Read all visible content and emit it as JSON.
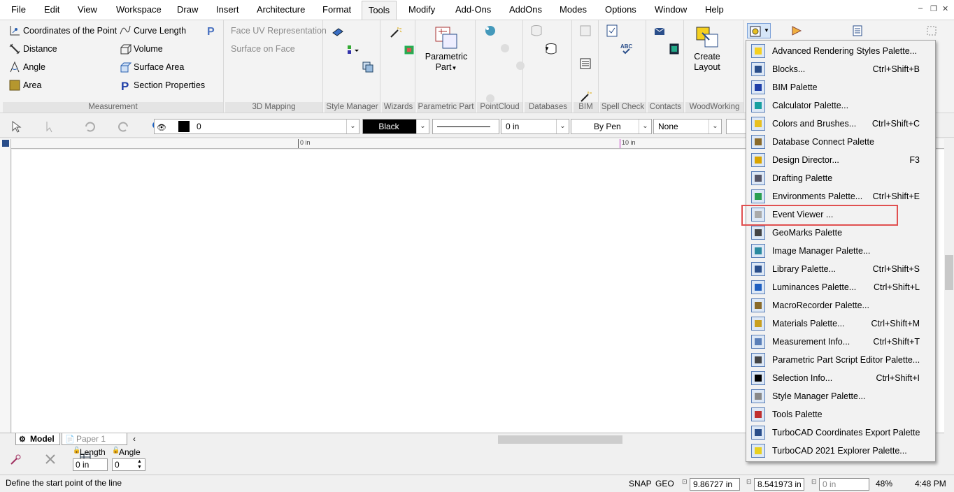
{
  "menu": {
    "items": [
      "File",
      "Edit",
      "View",
      "Workspace",
      "Draw",
      "Insert",
      "Architecture",
      "Format",
      "Tools",
      "Modify",
      "Add-Ons",
      "AddOns",
      "Modes",
      "Options",
      "Window",
      "Help"
    ],
    "active": "Tools"
  },
  "ribbon": {
    "measurement": {
      "col1": [
        "Coordinates of the Point",
        "Distance",
        "Angle",
        "Area"
      ],
      "col2": [
        "Curve Length",
        "Volume",
        "Surface Area",
        "Section Properties"
      ],
      "label": "Measurement"
    },
    "mapping": {
      "items": [
        "Face UV Representation",
        "Surface on Face"
      ],
      "label": "3D Mapping"
    },
    "parametric_part": {
      "button": "Parametric",
      "button2": "Part",
      "label": "Parametric Part"
    },
    "create_layout": {
      "line1": "Create",
      "line2": "Layout"
    },
    "group_labels": {
      "style_manager": "Style Manager",
      "wizards": "Wizards",
      "pointcloud": "PointCloud",
      "databases": "Databases",
      "bim": "BIM",
      "spell_check": "Spell Check",
      "contacts": "Contacts",
      "woodworking": "WoodWorking"
    }
  },
  "toolbar": {
    "layer_value": "0",
    "color_value": "Black",
    "thickness_value": "0 in",
    "pen_value": "By Pen",
    "fill_value": "None"
  },
  "ruler": {
    "mark0": "0 in",
    "mark10": "10 in"
  },
  "tabs": {
    "model": "Model",
    "paper": "Paper 1"
  },
  "inspector": {
    "length_label": "Length",
    "angle_label": "Angle",
    "length_value": "0 in",
    "angle_value": "0"
  },
  "status": {
    "message": "Define the start point of the line",
    "snap": "SNAP",
    "geo": "GEO",
    "x": "9.86727 in",
    "y": "8.541973 in",
    "z": "0 in",
    "zoom": "48%",
    "time": "4:48 PM"
  },
  "dropdown": {
    "items": [
      {
        "label": "Advanced Rendering Styles Palette...",
        "shortcut": ""
      },
      {
        "label": "Blocks...",
        "shortcut": "Ctrl+Shift+B"
      },
      {
        "label": "BIM Palette",
        "shortcut": ""
      },
      {
        "label": "Calculator Palette...",
        "shortcut": ""
      },
      {
        "label": "Colors and Brushes...",
        "shortcut": "Ctrl+Shift+C"
      },
      {
        "label": "Database Connect Palette",
        "shortcut": ""
      },
      {
        "label": "Design Director...",
        "shortcut": "F3"
      },
      {
        "label": "Drafting Palette",
        "shortcut": ""
      },
      {
        "label": "Environments Palette...",
        "shortcut": "Ctrl+Shift+E"
      },
      {
        "label": "Event Viewer ...",
        "shortcut": ""
      },
      {
        "label": "GeoMarks Palette",
        "shortcut": ""
      },
      {
        "label": "Image Manager Palette...",
        "shortcut": ""
      },
      {
        "label": "Library Palette...",
        "shortcut": "Ctrl+Shift+S"
      },
      {
        "label": "Luminances Palette...",
        "shortcut": "Ctrl+Shift+L"
      },
      {
        "label": "MacroRecorder Palette...",
        "shortcut": ""
      },
      {
        "label": "Materials Palette...",
        "shortcut": "Ctrl+Shift+M"
      },
      {
        "label": "Measurement Info...",
        "shortcut": "Ctrl+Shift+T"
      },
      {
        "label": "Parametric Part Script Editor Palette...",
        "shortcut": ""
      },
      {
        "label": "Selection Info...",
        "shortcut": "Ctrl+Shift+I"
      },
      {
        "label": "Style Manager Palette...",
        "shortcut": ""
      },
      {
        "label": "Tools Palette",
        "shortcut": ""
      },
      {
        "label": "TurboCAD Coordinates Export Palette",
        "shortcut": ""
      },
      {
        "label": "TurboCAD 2021 Explorer Palette...",
        "shortcut": ""
      }
    ],
    "highlight_color": "#e05050"
  }
}
